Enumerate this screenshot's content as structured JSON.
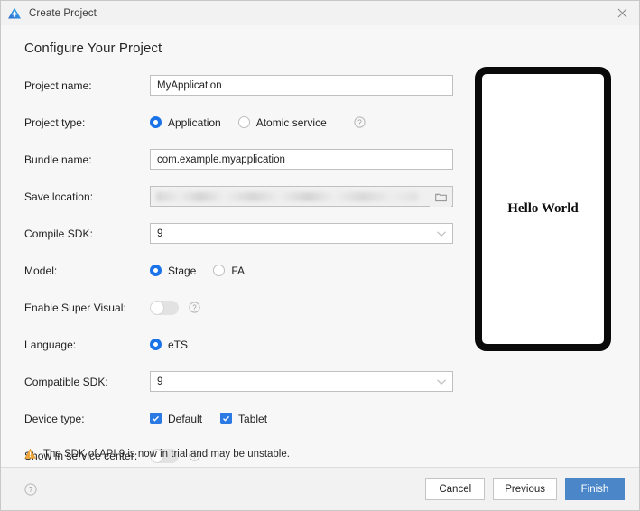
{
  "window": {
    "title": "Create Project",
    "logo_icon": "deveco-studio-logo",
    "close_icon": "close-icon"
  },
  "page": {
    "heading": "Configure Your Project"
  },
  "form": {
    "rows": [
      {
        "id": "project-name",
        "label": "Project name:",
        "type": "text",
        "value": "MyApplication",
        "placeholder": ""
      },
      {
        "id": "project-type",
        "label": "Project type:",
        "type": "radio",
        "options": [
          "Application",
          "Atomic service"
        ],
        "selected": "Application",
        "help": true
      },
      {
        "id": "bundle-name",
        "label": "Bundle name:",
        "type": "text",
        "value": "com.example.myapplication",
        "placeholder": ""
      },
      {
        "id": "save-location",
        "label": "Save location:",
        "type": "path",
        "value": "",
        "placeholder": "",
        "browse_icon": "folder-icon",
        "masked": true
      },
      {
        "id": "compile-sdk",
        "label": "Compile SDK:",
        "type": "combo",
        "value": "9"
      },
      {
        "id": "model",
        "label": "Model:",
        "type": "radio",
        "options": [
          "Stage",
          "FA"
        ],
        "selected": "Stage",
        "help": false
      },
      {
        "id": "enable-super-visual",
        "label": "Enable Super Visual:",
        "type": "toggle",
        "value": "off",
        "help": true
      },
      {
        "id": "language",
        "label": "Language:",
        "type": "radio",
        "options": [
          "eTS"
        ],
        "selected": "eTS",
        "help": false
      },
      {
        "id": "compatible-sdk",
        "label": "Compatible SDK:",
        "type": "combo",
        "value": "9"
      },
      {
        "id": "device-type",
        "label": "Device type:",
        "type": "checkbox",
        "options": [
          "Default",
          "Tablet"
        ],
        "checked": [
          "Default",
          "Tablet"
        ]
      },
      {
        "id": "show-in-service-center",
        "label": "Show in service center:",
        "type": "toggle",
        "value": "off",
        "help": true
      }
    ]
  },
  "warning": {
    "icon": "warning-triangle-icon",
    "text": "The SDK of API 9 is now in trial and may be unstable."
  },
  "preview": {
    "text": "Hello World"
  },
  "footer": {
    "help_icon": "help-circle-icon",
    "buttons": [
      {
        "label": "Cancel",
        "primary": false
      },
      {
        "label": "Previous",
        "primary": false
      },
      {
        "label": "Finish",
        "primary": true
      }
    ]
  },
  "colors": {
    "accent_blue": "#1a73e8",
    "checkbox_blue": "#2b7ae4",
    "primary_button": "#4a86c8",
    "warning_orange": "#e8a33d",
    "window_bg": "#f7f7f7",
    "titlebar_bg": "#f2f2f2"
  }
}
